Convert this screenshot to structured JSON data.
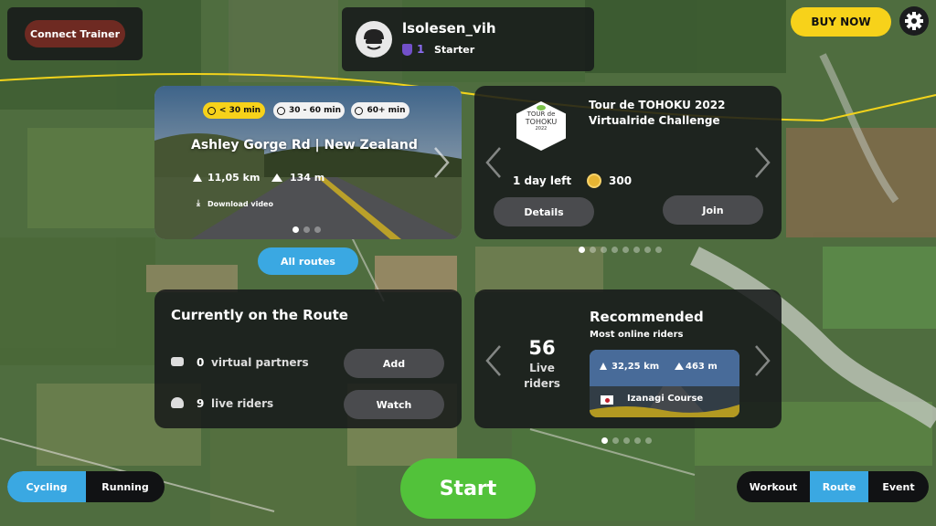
{
  "top": {
    "connect_trainer": "Connect Trainer",
    "buy_now": "BUY NOW",
    "settings_icon": "gear-icon"
  },
  "profile": {
    "username": "lsolesen_vih",
    "level": "1",
    "plan": "Starter",
    "avatar_icon": "avatar-helmet-icon"
  },
  "route_card": {
    "duration_filters": [
      "< 30 min",
      "30 - 60 min",
      "60+ min"
    ],
    "title": "Ashley Gorge Rd | New Zealand",
    "distance": "11,05 km",
    "elevation": "134 m",
    "download": "Download video",
    "all_routes": "All routes",
    "page_count": 3,
    "active_page": 0
  },
  "event_card": {
    "logo_line1": "TOUR de",
    "logo_line2": "TOHOKU",
    "logo_year": "2022",
    "title_line1": "Tour de TOHOKU 2022",
    "title_line2": "Virtualride Challenge",
    "time_left": "1 day left",
    "points": "300",
    "details": "Details",
    "join": "Join",
    "page_count": 8,
    "active_page": 0
  },
  "current": {
    "title": "Currently on the Route",
    "partners_count": "0",
    "partners_label": "virtual partners",
    "add": "Add",
    "riders_count": "9",
    "riders_label": "live riders",
    "watch": "Watch"
  },
  "recommended": {
    "live_count": "56",
    "live_label_1": "Live",
    "live_label_2": "riders",
    "title": "Recommended",
    "subtitle": "Most online riders",
    "distance": "32,25 km",
    "elevation": "463 m",
    "course": "Izanagi Course",
    "page_count": 5,
    "active_page": 0
  },
  "bottom": {
    "sport_tabs": [
      "Cycling",
      "Running"
    ],
    "active_sport": "Cycling",
    "start": "Start",
    "mode_tabs": [
      "Workout",
      "Route",
      "Event"
    ],
    "active_mode": "Route"
  },
  "colors": {
    "accent_blue": "#3aa8e2",
    "start_green": "#52c23a",
    "buy_yellow": "#f7d21a",
    "trainer_red": "#6e2a22",
    "route_yellow": "#f2d31b"
  }
}
